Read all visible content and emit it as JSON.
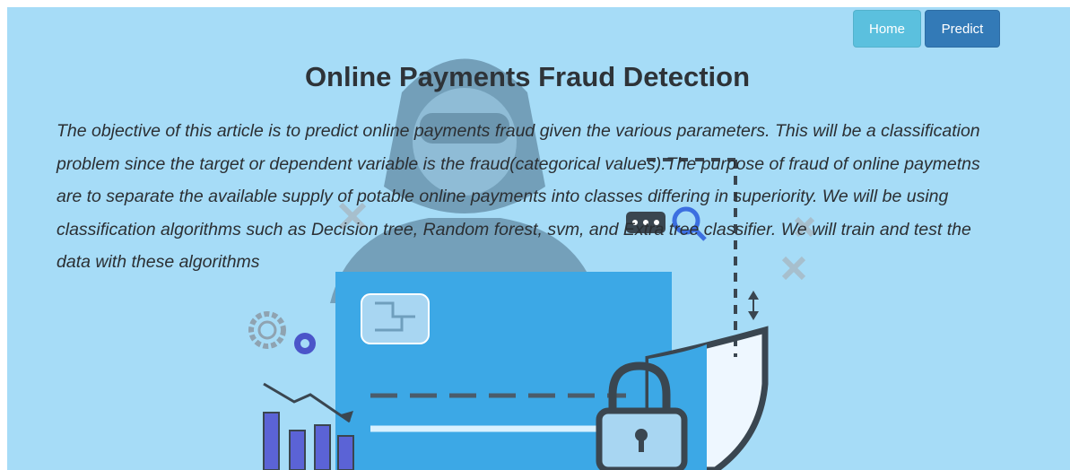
{
  "nav": {
    "home_label": "Home",
    "predict_label": "Predict"
  },
  "page": {
    "title": "Online Payments Fraud Detection",
    "description": "The objective of this article is to predict online payments fraud given the various parameters. This will be a classification problem since the target or dependent variable is the fraud(categorical values).The purpose of fraud of online paymetns are to separate the available supply of potable online payments into classes differing in superiority. We will be using classification algorithms such as Decision tree, Random forest, svm, and Extra tree classifier. We will train and test the data with these algorithms"
  },
  "colors": {
    "page_background": "#a6dcf7",
    "home_button": "#5bc0de",
    "predict_button": "#337ab7",
    "card": "#3ca8e6"
  },
  "background_illustration": {
    "icons": [
      "hacker-icon",
      "credit-card-icon",
      "shield-lock-icon",
      "gears-icon",
      "bar-chart-icon",
      "password-search-icon",
      "close-icon"
    ]
  }
}
